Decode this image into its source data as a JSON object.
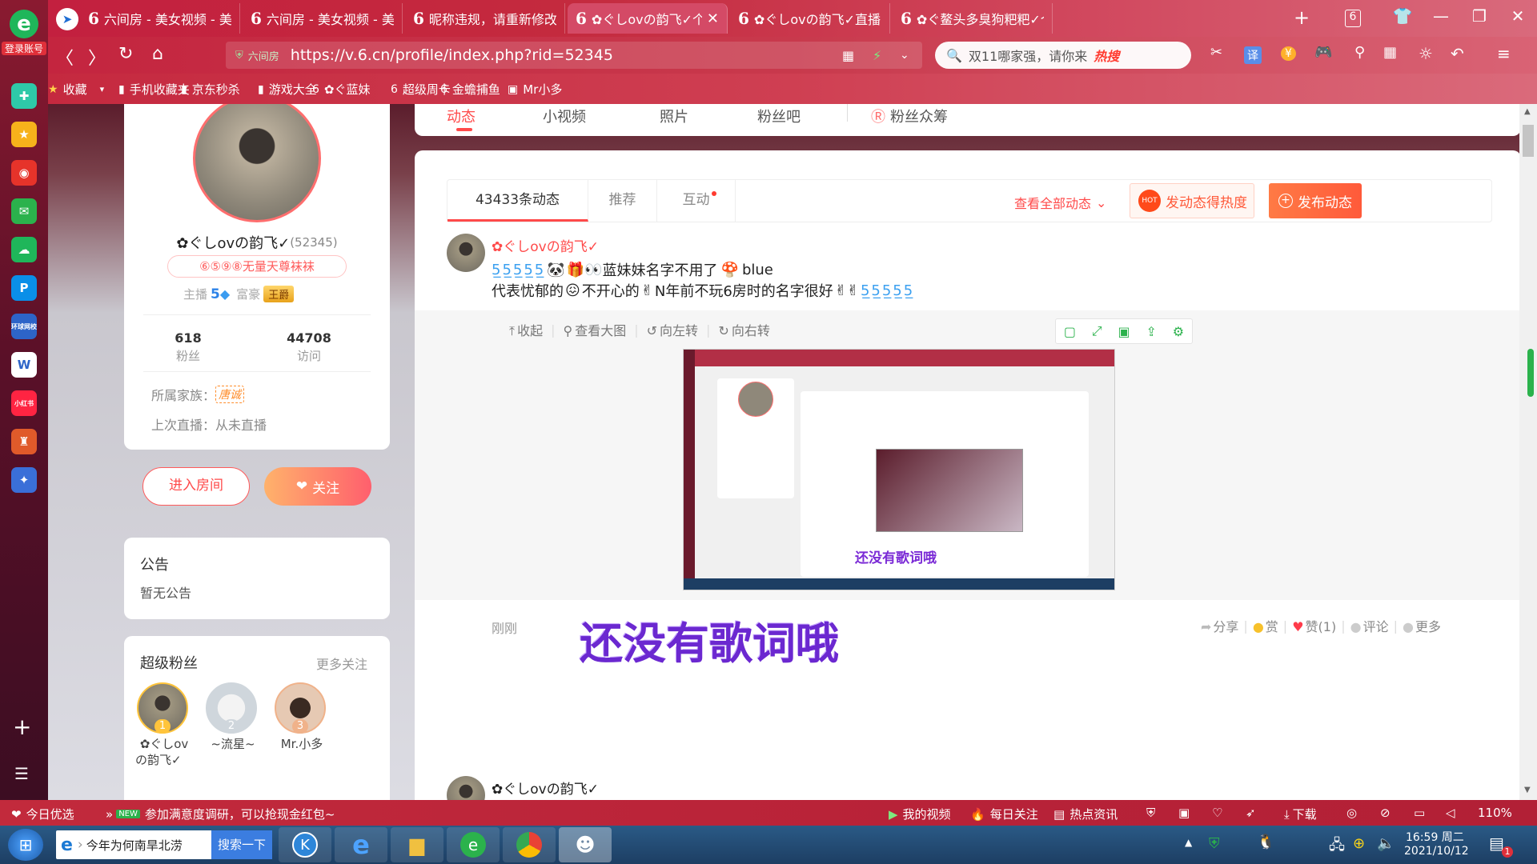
{
  "colors": {
    "accent": "#ff5a4a",
    "brand_red": "#c3203f",
    "orange": "#ff7a45"
  },
  "sidebar": {
    "login_label": "登录账号",
    "items": [
      {
        "icon": "plus-diamond-icon",
        "label": "",
        "color": "#2ec9a8"
      },
      {
        "icon": "star-icon",
        "label": "",
        "color": "#f7b21b"
      },
      {
        "icon": "weibo-icon",
        "label": "",
        "color": "#e6332a"
      },
      {
        "icon": "mail-icon",
        "label": "",
        "color": "#2bb24c"
      },
      {
        "icon": "cloud-icon",
        "label": "",
        "color": "#1fb65a"
      },
      {
        "icon": "p-icon",
        "label": "",
        "color": "#0a8fe8"
      },
      {
        "icon": "game-box-icon",
        "label": "环球网校",
        "color": "#2d64c8"
      },
      {
        "icon": "word-icon",
        "label": "",
        "color": "#ffffff"
      },
      {
        "icon": "xiaohongshu-icon",
        "label": "小红书",
        "color": "#ff2442"
      },
      {
        "icon": "game-icon",
        "label": "",
        "color": "#e05a2a"
      },
      {
        "icon": "game2-icon",
        "label": "",
        "color": "#3a6fd8"
      }
    ]
  },
  "tabs": [
    {
      "title": "六间房 - 美女视频 - 美女"
    },
    {
      "title": "六间房 - 美女视频 - 美"
    },
    {
      "title": "昵称违规，请重新修改直"
    },
    {
      "title": "✿ぐしovの韵飞✓个人动态",
      "active": true
    },
    {
      "title": "✿ぐしovの韵飞✓直播间"
    },
    {
      "title": "✿ぐ鳌头多臭狗粑粑✓个人"
    }
  ],
  "tab_count": "6",
  "nav": {
    "url": "https://v.6.cn/profile/index.php?rid=52345",
    "url_prefix": "六间房",
    "search_text": "双11哪家强，请你来",
    "hot_label": "热搜"
  },
  "bookmarks": [
    "收藏",
    "手机收藏夹",
    "京东秒杀",
    "游戏大全",
    "✿ぐ蓝妹",
    "超级周卡",
    "金蟾捕鱼",
    "Mr小多"
  ],
  "profile": {
    "name": "✿ぐしovの韵飞✓",
    "id": "(52345)",
    "title_badge": "⑥⑤⑨⑧无量天尊袜袜",
    "anchor_label": "主播",
    "anchor_level": "5",
    "rich_label": "富豪",
    "rich_badge": "王爵",
    "fans_count": "618",
    "fans_label": "粉丝",
    "visits_count": "44708",
    "visits_label": "访问",
    "family_label": "所属家族：",
    "family_value": "唐诚",
    "last_live": "上次直播：从未直播",
    "enter_room": "进入房间",
    "follow": "关注"
  },
  "notice": {
    "title": "公告",
    "content": "暂无公告"
  },
  "superfans": {
    "title": "超级粉丝",
    "more": "更多关注",
    "fans": [
      {
        "rank": "1",
        "name1": "✿ぐしov",
        "name2": "の韵飞✓"
      },
      {
        "rank": "2",
        "name1": "~流星~",
        "name2": ""
      },
      {
        "rank": "3",
        "name1": "Mr.小多",
        "name2": ""
      }
    ]
  },
  "top_nav": [
    "动态",
    "小视频",
    "照片",
    "粉丝吧",
    "粉丝众筹"
  ],
  "feed_tabs": {
    "count": "43433条动态",
    "recommend": "推荐",
    "interact": "互动",
    "view_all": "查看全部动态",
    "promote": "发动态得热度",
    "publish": "发布动态",
    "hot_badge": "HOT"
  },
  "post": {
    "author": "✿ぐしovの韵飞✓",
    "line1_text": "蓝妹妹名字不用了",
    "line1_tail": "blue",
    "line2_a": "代表忧郁的",
    "line2_b": "不开心的",
    "line2_c": "N年前不玩6房时的名字很好",
    "tools": [
      "收起",
      "查看大图",
      "向左转",
      "向右转"
    ],
    "time": "刚刚",
    "caption": "还没有歌词哦",
    "actions": [
      "分享",
      "赏",
      "赞(1)",
      "评论",
      "更多"
    ]
  },
  "next_post_author": "✿ぐしovの韵飞✓",
  "status": {
    "left1": "今日优选",
    "new_badge": "NEW",
    "news": "参加满意度调研，可以抢现金红包~",
    "my_video": "我的视频",
    "daily": "每日关注",
    "hotnews": "热点资讯",
    "download": "下载",
    "zoom": "110%"
  },
  "taskbar": {
    "search_text": "今年为何南旱北涝",
    "search_btn": "搜索一下",
    "time": "16:59 周二",
    "date": "2021/10/12",
    "badge": "1"
  }
}
